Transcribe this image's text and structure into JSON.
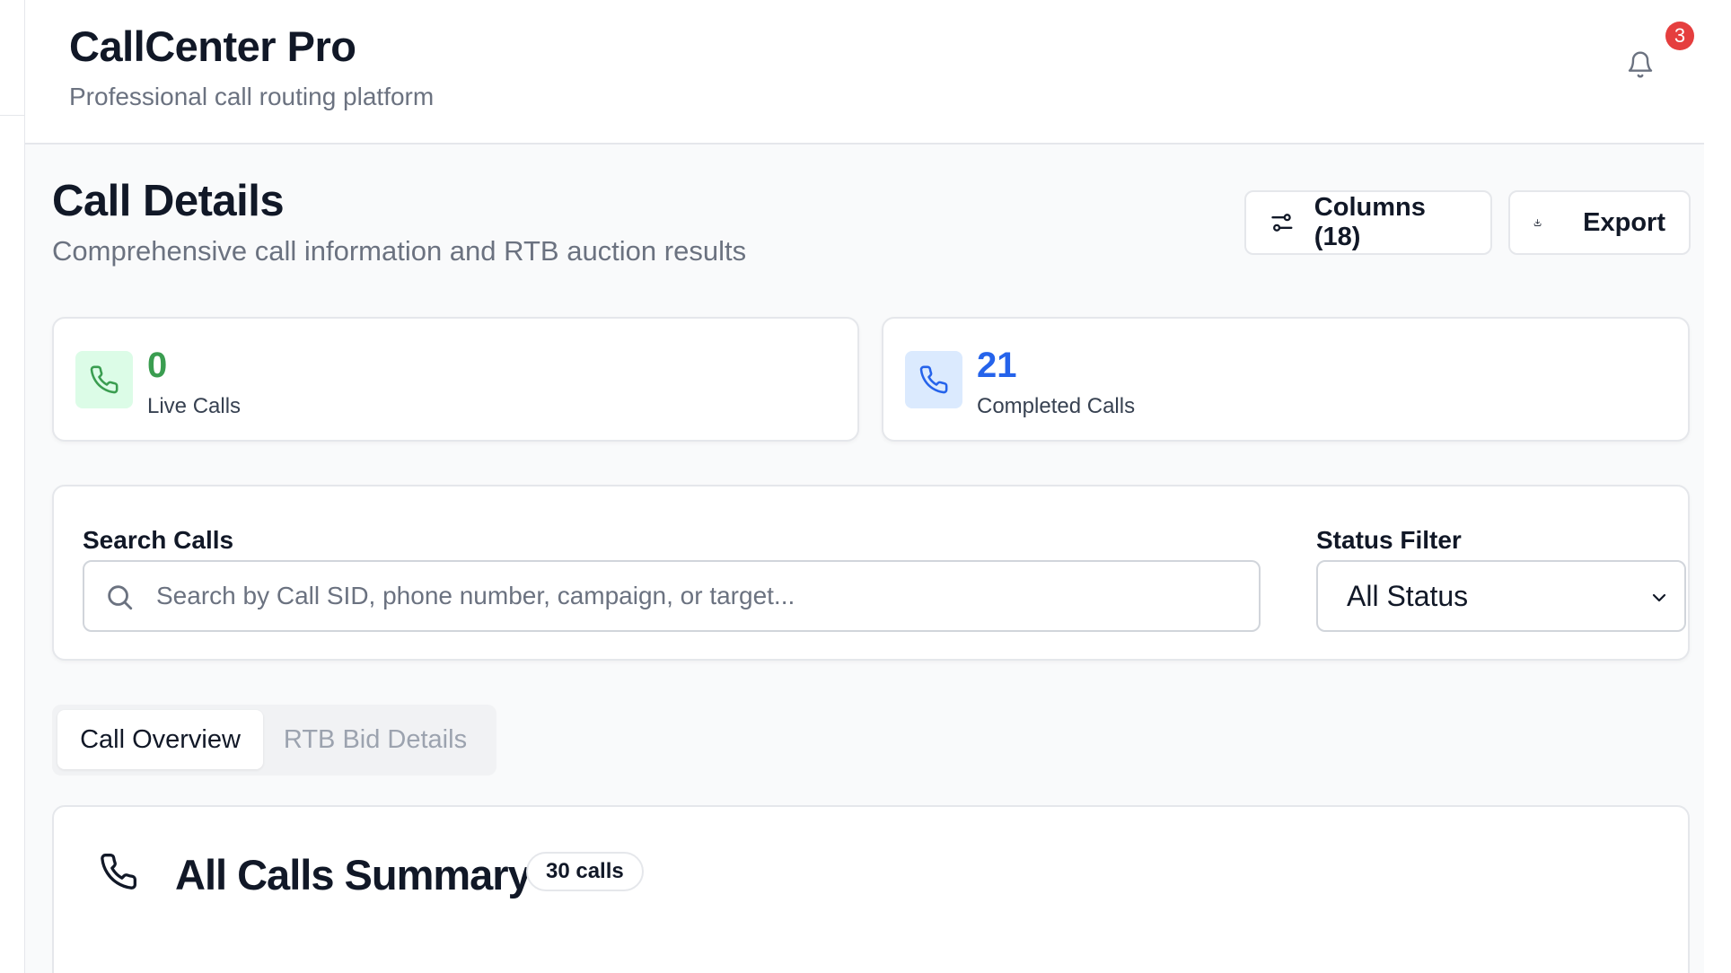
{
  "header": {
    "app_title": "CallCenter Pro",
    "app_subtitle": "Professional call routing platform",
    "notification_count": "3"
  },
  "page": {
    "title": "Call Details",
    "subtitle": "Comprehensive call information and RTB auction results"
  },
  "toolbar": {
    "columns_label": "Columns (18)",
    "export_label": "Export"
  },
  "stats": {
    "live": {
      "value": "0",
      "label": "Live Calls",
      "color": "#3a9d50"
    },
    "completed": {
      "value": "21",
      "label": "Completed Calls",
      "color": "#2563eb"
    }
  },
  "filters": {
    "search_label": "Search Calls",
    "search_placeholder": "Search by Call SID, phone number, campaign, or target...",
    "search_value": "",
    "status_label": "Status Filter",
    "status_selected": "All Status"
  },
  "tabs": [
    {
      "label": "Call Overview",
      "active": true
    },
    {
      "label": "RTB Bid Details",
      "active": false
    }
  ],
  "summary": {
    "title": "All Calls Summary",
    "badge": "30 calls"
  },
  "icons": {
    "bell": "bell-icon",
    "columns": "sliders-icon",
    "export": "download-icon",
    "phone": "phone-icon",
    "search": "search-icon",
    "chevron": "chevron-down-icon"
  }
}
